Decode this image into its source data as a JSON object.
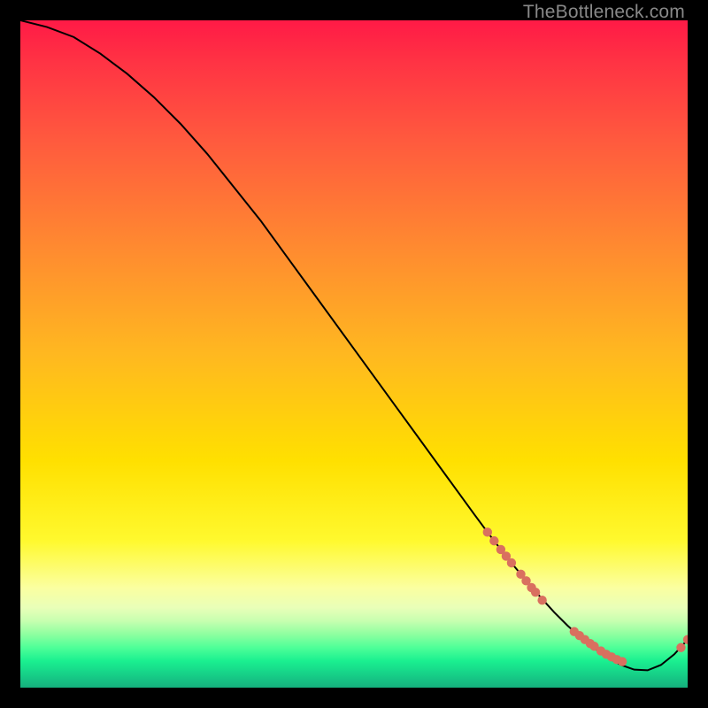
{
  "watermark": "TheBottleneck.com",
  "colors": {
    "curve_stroke": "#000000",
    "marker_fill": "#d9705f",
    "background": "#000000"
  },
  "chart_data": {
    "type": "line",
    "title": "",
    "xlabel": "",
    "ylabel": "",
    "xlim": [
      0,
      100
    ],
    "ylim": [
      0,
      100
    ],
    "grid": false,
    "legend": false,
    "series": [
      {
        "name": "bottleneck-curve",
        "x": [
          0,
          4,
          8,
          12,
          16,
          20,
          24,
          28,
          32,
          36,
          40,
          44,
          48,
          52,
          56,
          60,
          64,
          68,
          70,
          72,
          74,
          76,
          78,
          80,
          82,
          84,
          86,
          88,
          90,
          92,
          94,
          96,
          98,
          100
        ],
        "y": [
          100,
          99,
          97.5,
          95,
          92,
          88.5,
          84.5,
          80,
          75,
          70,
          64.5,
          59,
          53.5,
          48,
          42.5,
          37,
          31.5,
          26,
          23.3,
          20.7,
          18.2,
          15.8,
          13.5,
          11.3,
          9.3,
          7.5,
          5.9,
          4.5,
          3.4,
          2.7,
          2.6,
          3.4,
          5.0,
          7.2
        ]
      }
    ],
    "markers": [
      {
        "x": 70.0,
        "y": 23.3
      },
      {
        "x": 71.0,
        "y": 22.0
      },
      {
        "x": 72.0,
        "y": 20.7
      },
      {
        "x": 72.8,
        "y": 19.7
      },
      {
        "x": 73.6,
        "y": 18.7
      },
      {
        "x": 75.0,
        "y": 17.0
      },
      {
        "x": 75.8,
        "y": 16.0
      },
      {
        "x": 76.6,
        "y": 15.0
      },
      {
        "x": 77.2,
        "y": 14.3
      },
      {
        "x": 78.2,
        "y": 13.1
      },
      {
        "x": 83.0,
        "y": 8.4
      },
      {
        "x": 83.8,
        "y": 7.8
      },
      {
        "x": 84.6,
        "y": 7.2
      },
      {
        "x": 85.4,
        "y": 6.6
      },
      {
        "x": 86.0,
        "y": 6.2
      },
      {
        "x": 87.0,
        "y": 5.5
      },
      {
        "x": 87.8,
        "y": 5.0
      },
      {
        "x": 88.6,
        "y": 4.6
      },
      {
        "x": 89.4,
        "y": 4.2
      },
      {
        "x": 90.2,
        "y": 3.9
      },
      {
        "x": 99.0,
        "y": 6.0
      },
      {
        "x": 100.0,
        "y": 7.2
      }
    ]
  }
}
